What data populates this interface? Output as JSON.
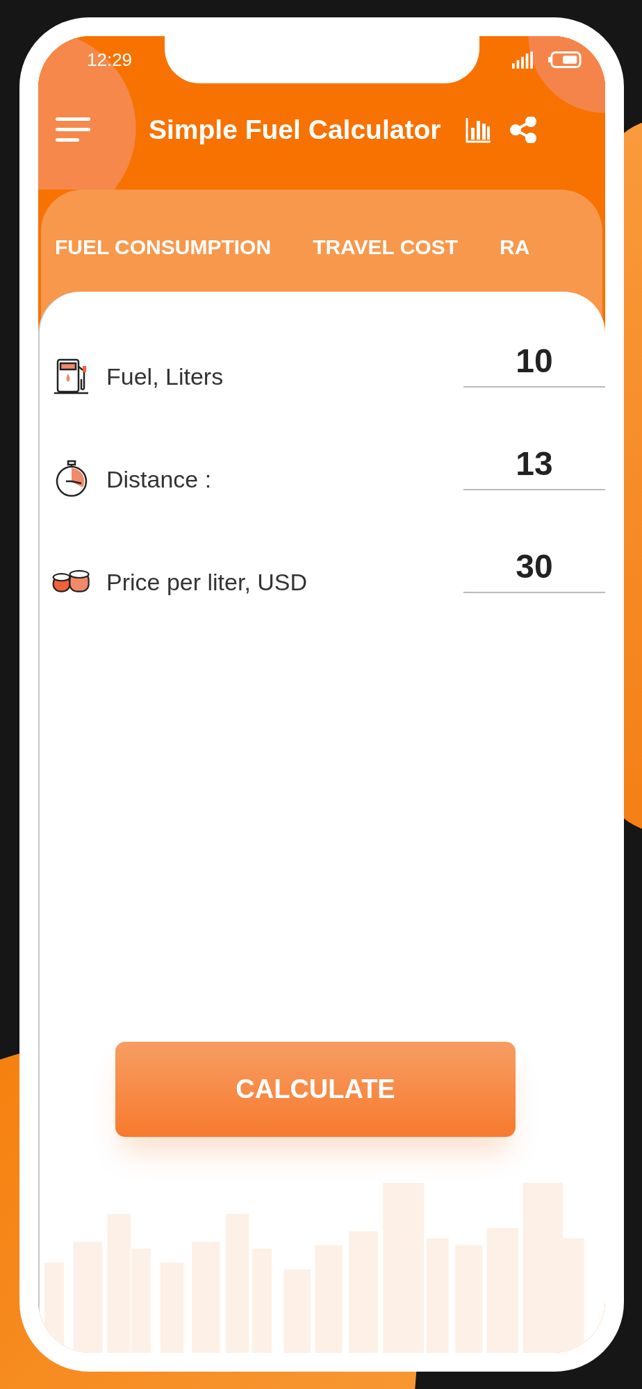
{
  "status_bar": {
    "time": "12:29"
  },
  "app_bar": {
    "title": "Simple Fuel Calculator"
  },
  "tabs": [
    {
      "label": "FUEL CONSUMPTION"
    },
    {
      "label": "TRAVEL COST"
    },
    {
      "label": "RA"
    }
  ],
  "fields": [
    {
      "kind": "pump",
      "label": "Fuel, Liters",
      "value": "10"
    },
    {
      "kind": "stopwatch",
      "label": "Distance :",
      "value": "13"
    },
    {
      "kind": "coins",
      "label": "Price per liter, USD",
      "value": "30"
    }
  ],
  "button": {
    "label": "CALCULATE"
  }
}
